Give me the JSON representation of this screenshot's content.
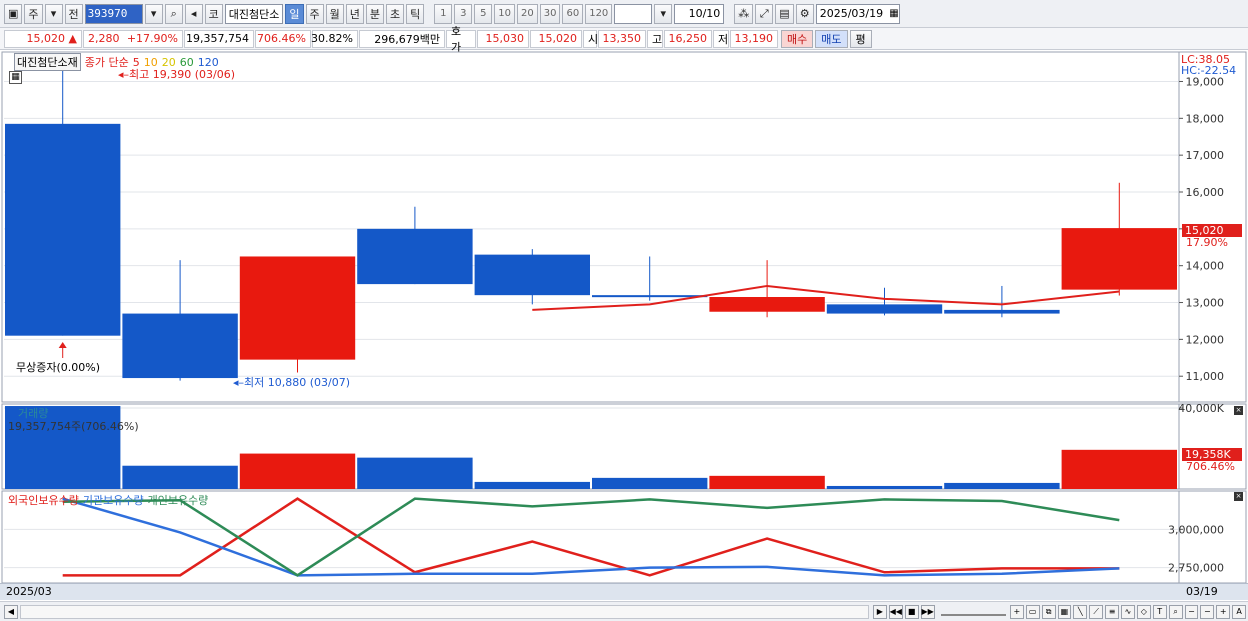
{
  "toolbar": {
    "market": "주",
    "market2": "전",
    "code": "393970",
    "code_label": "코",
    "name": "대진첨단소",
    "periods": [
      "일",
      "주",
      "월",
      "년",
      "분",
      "초",
      "틱"
    ],
    "active_period": "일",
    "numbers": [
      "1",
      "3",
      "5",
      "10",
      "20",
      "30",
      "60",
      "120"
    ],
    "count": "10/10",
    "date": "2025/03/19"
  },
  "quote": {
    "price": "15,020",
    "change": "2,280",
    "change_pct": "+17.90%",
    "volume": "19,357,754",
    "volume_ratio": "706.46%",
    "turnover": "30.82%",
    "amount": "296,679백만",
    "bid_label": "호가",
    "ask": "15,030",
    "bid": "15,020",
    "open_label": "시",
    "open": "13,350",
    "high_label": "고",
    "high": "16,250",
    "low_label": "저",
    "low": "13,190",
    "buy_label": "매수",
    "sell_label": "매도",
    "eval_label": "평"
  },
  "price_panel": {
    "stock_name": "대진첨단소재",
    "ma_label": "종가 단순",
    "ma_periods": [
      {
        "label": "5",
        "color": "#e0201c"
      },
      {
        "label": "10",
        "color": "#f0a000"
      },
      {
        "label": "20",
        "color": "#d6c400"
      },
      {
        "label": "60",
        "color": "#2a9a3a"
      },
      {
        "label": "120",
        "color": "#1f5bd1"
      }
    ],
    "max_label": "최고 19,390 (03/06)",
    "min_label": "최저 10,880 (03/07)",
    "event_label": "무상증자(0.00%)",
    "lc": "LC:38.05",
    "hc": "HC:-22.54",
    "current_price_tag": "15,020",
    "current_pct_tag": "17.90%"
  },
  "volume_panel": {
    "title": "거래량",
    "value_label": "19,357,754주(706.46%)",
    "current_tag": "19,358K",
    "current_pct_tag": "706.46%"
  },
  "holdings_panel": {
    "legend": [
      {
        "label": "외국인보유수량",
        "color": "#e0201c"
      },
      {
        "label": "기관보유수량",
        "color": "#2f6fdc"
      },
      {
        "label": "개인보유수량",
        "color": "#2e8b57"
      }
    ]
  },
  "time_axis": {
    "start": "2025/03",
    "end": "03/19"
  },
  "chart_data": [
    {
      "type": "candlestick",
      "title": "대진첨단소재",
      "y_ticks": [
        11000,
        12000,
        13000,
        14000,
        15000,
        16000,
        17000,
        18000,
        19000
      ],
      "y_tick_labels": [
        "11,000",
        "12,000",
        "13,000",
        "14,000",
        "15,000",
        "16,000",
        "17,000",
        "18,000",
        "19,000"
      ],
      "ylim": [
        10300,
        19800
      ],
      "candles": [
        {
          "open": 12100,
          "close": 17850,
          "high": 19390,
          "low": 12100,
          "color": "blue"
        },
        {
          "open": 12700,
          "close": 10950,
          "high": 14150,
          "low": 10880,
          "color": "blue"
        },
        {
          "open": 11450,
          "close": 14250,
          "high": 14250,
          "low": 11100,
          "color": "red"
        },
        {
          "open": 15000,
          "close": 13500,
          "high": 15600,
          "low": 13500,
          "color": "blue"
        },
        {
          "open": 14300,
          "close": 13200,
          "high": 14450,
          "low": 12950,
          "color": "blue"
        },
        {
          "open": 13200,
          "close": 13150,
          "high": 14250,
          "low": 13050,
          "color": "blue"
        },
        {
          "open": 12750,
          "close": 13150,
          "high": 14150,
          "low": 12600,
          "color": "red"
        },
        {
          "open": 12950,
          "close": 12700,
          "high": 13400,
          "low": 12650,
          "color": "blue"
        },
        {
          "open": 12800,
          "close": 12700,
          "high": 13450,
          "low": 12600,
          "color": "blue"
        },
        {
          "open": 13350,
          "close": 15020,
          "high": 16250,
          "low": 13190,
          "color": "red"
        }
      ],
      "ma5": {
        "start_index": 4,
        "values": [
          12800,
          12950,
          13450,
          13100,
          12950,
          13300
        ]
      }
    },
    {
      "type": "bar",
      "title": "거래량",
      "y_ticks": [
        40000
      ],
      "y_tick_labels": [
        "40,000K"
      ],
      "ylim": [
        0,
        42000
      ],
      "values": [
        41000,
        11500,
        17500,
        15500,
        3500,
        5500,
        6500,
        1500,
        3000,
        19358
      ],
      "colors": [
        "blue",
        "blue",
        "red",
        "blue",
        "blue",
        "blue",
        "red",
        "blue",
        "blue",
        "red"
      ]
    },
    {
      "type": "line",
      "y_ticks": [
        2750000,
        3000000
      ],
      "y_tick_labels": [
        "2,750,000",
        "3,000,000"
      ],
      "ylim": [
        2650000,
        3250000
      ],
      "series": [
        {
          "name": "외국인보유수량",
          "color": "#e0201c",
          "values": [
            2700000,
            2700000,
            3200000,
            2720000,
            2920000,
            2700000,
            2940000,
            2720000,
            2745000,
            2745000
          ]
        },
        {
          "name": "기관보유수량",
          "color": "#2f6fdc",
          "values": [
            3200000,
            2980000,
            2700000,
            2710000,
            2710000,
            2750000,
            2755000,
            2700000,
            2710000,
            2745000
          ]
        },
        {
          "name": "개인보유수량",
          "color": "#2e8b57",
          "values": [
            3180000,
            3190000,
            2700000,
            3200000,
            3150000,
            3195000,
            3140000,
            3195000,
            3185000,
            3060000
          ]
        }
      ]
    }
  ]
}
